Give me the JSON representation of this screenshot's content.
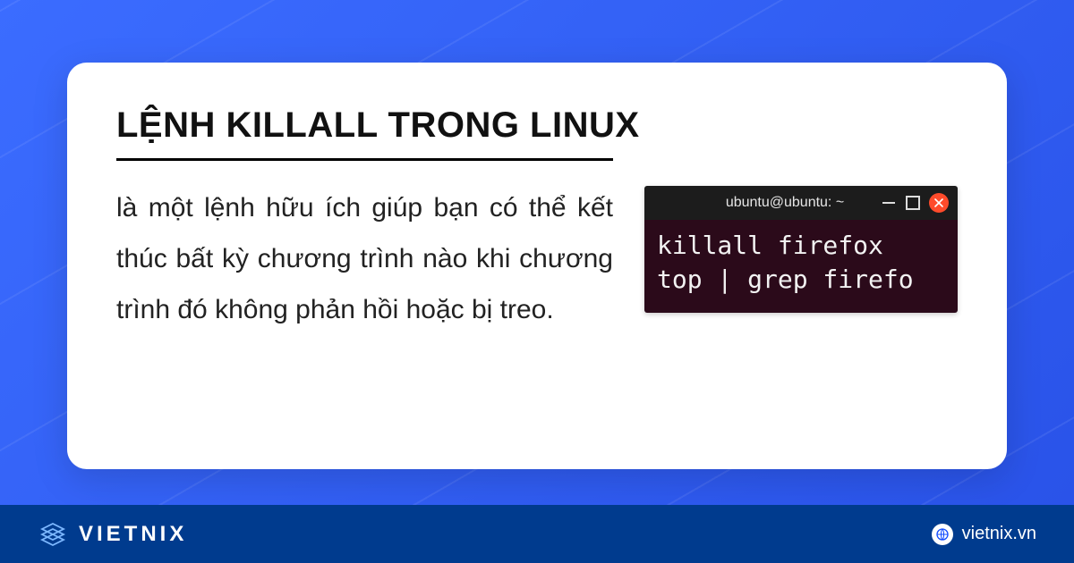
{
  "card": {
    "title": "LỆNH KILLALL TRONG LINUX",
    "description": "là một lệnh hữu ích giúp bạn có thể kết thúc bất kỳ chương trình nào khi chương trình đó không phản hồi hoặc bị treo."
  },
  "terminal": {
    "title": "ubuntu@ubuntu: ~",
    "line1": "killall firefox",
    "line2": "top | grep firefo"
  },
  "footer": {
    "brand": "VIETNIX",
    "url": "vietnix.vn"
  }
}
